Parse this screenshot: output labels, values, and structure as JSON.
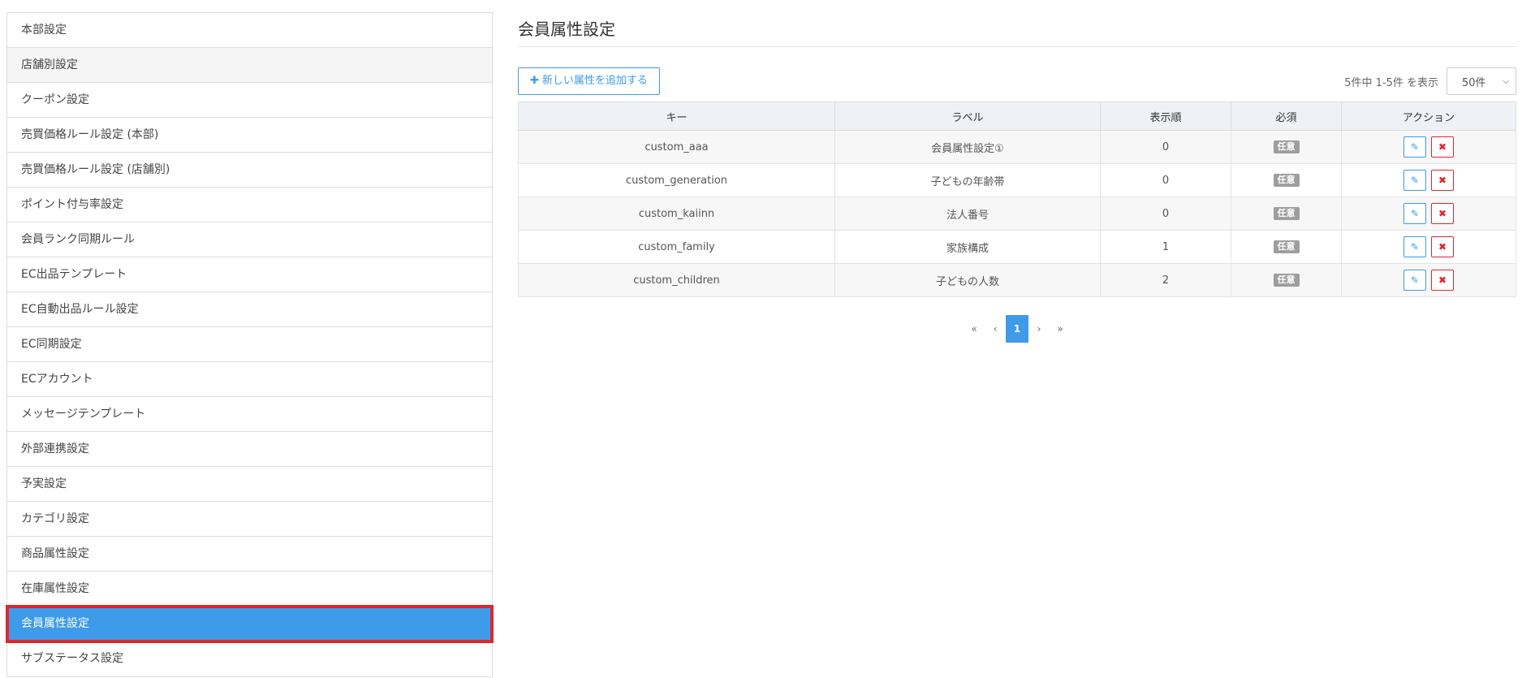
{
  "sidebar": {
    "items": [
      {
        "label": "本部設定"
      },
      {
        "label": "店舗別設定"
      },
      {
        "label": "クーポン設定"
      },
      {
        "label": "売買価格ルール設定 (本部)"
      },
      {
        "label": "売買価格ルール設定 (店舗別)"
      },
      {
        "label": "ポイント付与率設定"
      },
      {
        "label": "会員ランク同期ルール"
      },
      {
        "label": "EC出品テンプレート"
      },
      {
        "label": "EC自動出品ルール設定"
      },
      {
        "label": "EC同期設定"
      },
      {
        "label": "ECアカウント"
      },
      {
        "label": "メッセージテンプレート"
      },
      {
        "label": "外部連携設定"
      },
      {
        "label": "予実設定"
      },
      {
        "label": "カテゴリ設定"
      },
      {
        "label": "商品属性設定"
      },
      {
        "label": "在庫属性設定"
      },
      {
        "label": "会員属性設定"
      },
      {
        "label": "サブステータス設定"
      }
    ]
  },
  "main": {
    "title": "会員属性設定",
    "add_button_label": "新しい属性を追加する",
    "plus_glyph": "✚",
    "count_text": "5件中 1-5件 を表示",
    "per_page": "50件"
  },
  "table": {
    "headers": {
      "key": "キー",
      "label": "ラベル",
      "order": "表示順",
      "required": "必須",
      "action": "アクション"
    },
    "rows": [
      {
        "key": "custom_aaa",
        "label": "会員属性設定①",
        "order": "0",
        "required": "任意"
      },
      {
        "key": "custom_generation",
        "label": "子どもの年齢帯",
        "order": "0",
        "required": "任意"
      },
      {
        "key": "custom_kaiinn",
        "label": "法人番号",
        "order": "0",
        "required": "任意"
      },
      {
        "key": "custom_family",
        "label": "家族構成",
        "order": "1",
        "required": "任意"
      },
      {
        "key": "custom_children",
        "label": "子どもの人数",
        "order": "2",
        "required": "任意"
      }
    ]
  },
  "pagination": {
    "first": "«",
    "prev": "‹",
    "current": "1",
    "next": "›",
    "last": "»"
  },
  "icons": {
    "edit": "✎",
    "delete": "✖",
    "chevron": "⌵"
  },
  "colors": {
    "accent": "#3d9be9",
    "danger": "#e0262d",
    "badge": "#9e9e9e"
  }
}
